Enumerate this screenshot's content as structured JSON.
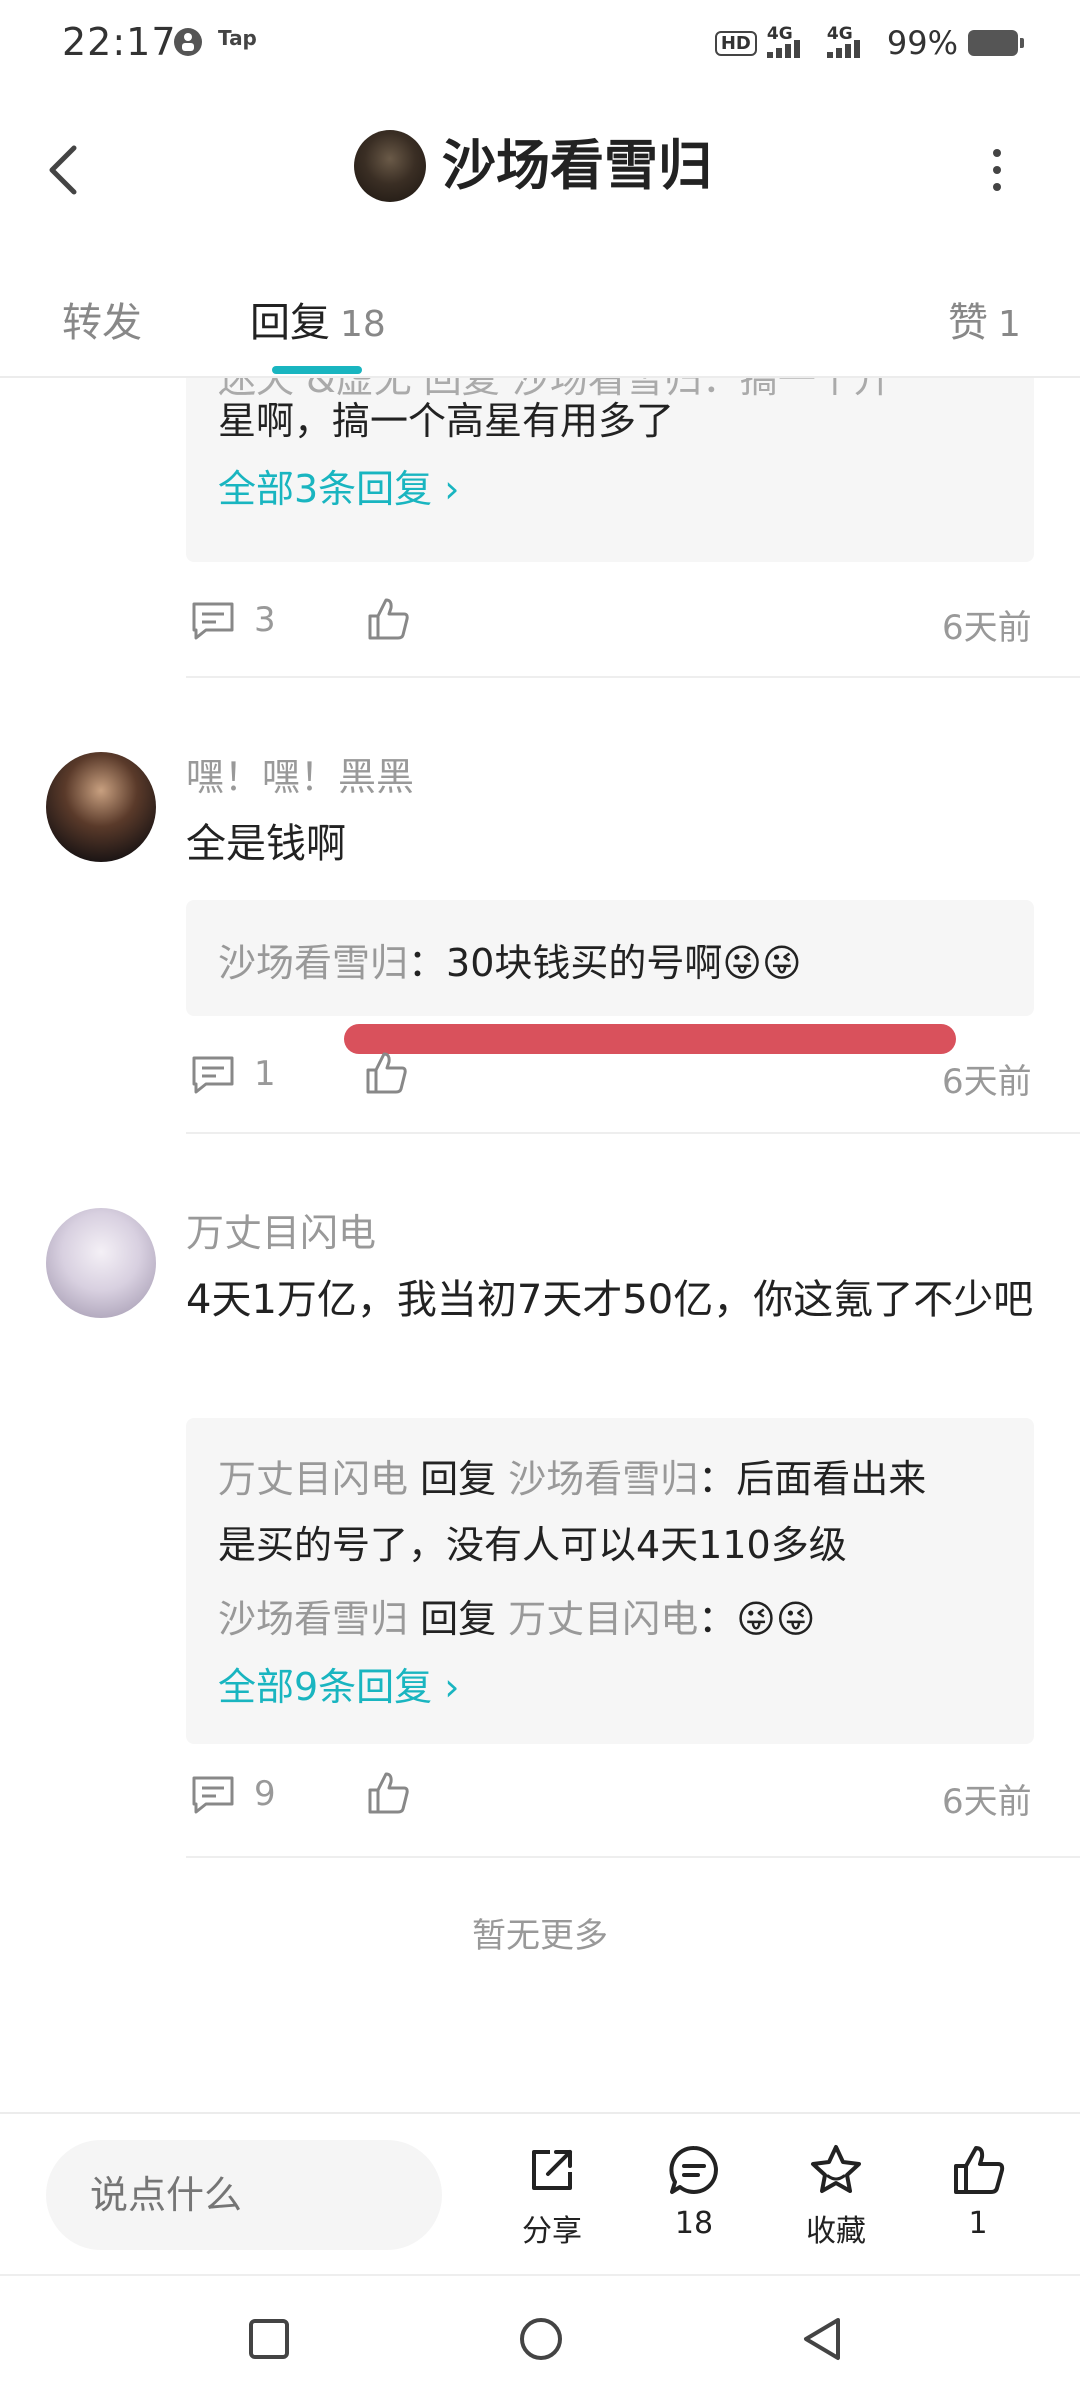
{
  "status": {
    "time": "22:17",
    "tap_label": "Tap",
    "hd": "HD",
    "net1": "4G",
    "net2": "4G",
    "battery": "99%"
  },
  "header": {
    "title": "沙场看雪归"
  },
  "tabs": {
    "forward": "转发",
    "reply": "回复",
    "reply_count": "18",
    "like": "赞",
    "like_count": "1"
  },
  "comments": [
    {
      "partial_line1": "迷天 &amp;虚无 回复 沙场看雪归：搞一个升",
      "line2": "星啊，搞一个高星有用多了",
      "all_replies": "全部3条回复",
      "reply_count": "3",
      "time": "6天前"
    },
    {
      "username": "嘿！嘿！黑黑",
      "text": "全是钱啊",
      "replies": [
        {
          "from": "沙场看雪归",
          "sep": "：",
          "text": "30块钱买的号啊😜😜"
        }
      ],
      "reply_count": "1",
      "time": "6天前"
    },
    {
      "username": "万丈目闪电",
      "text": "4天1万亿，我当初7天才50亿，你这氪了不少吧",
      "replies": [
        {
          "from": "万丈目闪电",
          "verb": "回复",
          "to": "沙场看雪归",
          "sep": "：",
          "text1": "后面看出来",
          "text2": "是买的号了，没有人可以4天110多级"
        },
        {
          "from": "沙场看雪归",
          "verb": "回复",
          "to": "万丈目闪电",
          "sep": "：",
          "text": "😜😜"
        }
      ],
      "all_replies": "全部9条回复",
      "reply_count": "9",
      "time": "6天前"
    }
  ],
  "no_more": "暂无更多",
  "bottom": {
    "input_placeholder": "说点什么",
    "share": "分享",
    "comments": "18",
    "favorite": "收藏",
    "likes": "1"
  },
  "colors": {
    "accent": "#19b5c0",
    "highlight_stroke": "#d9515c"
  }
}
